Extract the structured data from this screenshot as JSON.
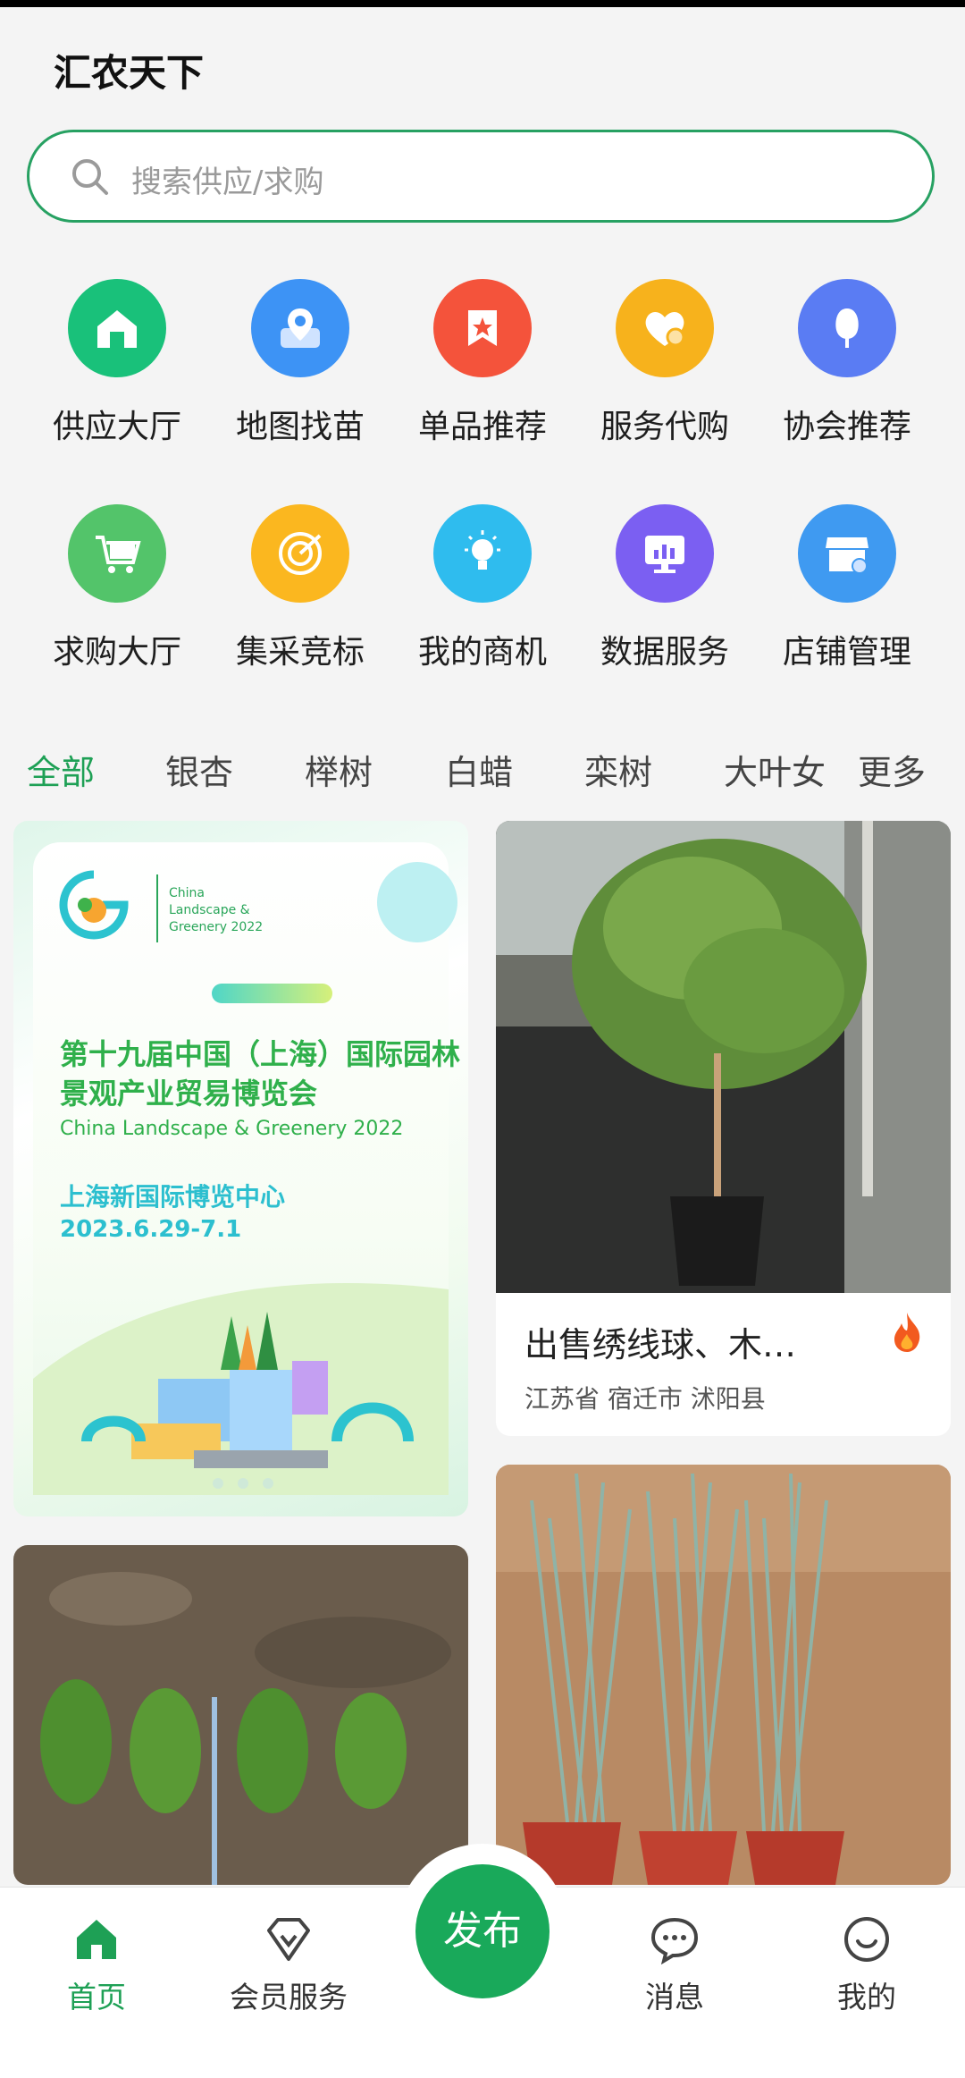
{
  "app": {
    "title": "汇农天下"
  },
  "search": {
    "placeholder": "搜索供应/求购"
  },
  "grid": [
    {
      "label": "供应大厅",
      "icon": "house-icon",
      "color": "#19c17a"
    },
    {
      "label": "地图找苗",
      "icon": "map-pin-icon",
      "color": "#3d93f5"
    },
    {
      "label": "单品推荐",
      "icon": "star-tag-icon",
      "color": "#f4533b"
    },
    {
      "label": "服务代购",
      "icon": "heart-icon",
      "color": "#f7b21c"
    },
    {
      "label": "协会推荐",
      "icon": "tree-icon",
      "color": "#5a7cf3"
    },
    {
      "label": "求购大厅",
      "icon": "cart-icon",
      "color": "#53c46a"
    },
    {
      "label": "集采竞标",
      "icon": "target-icon",
      "color": "#fbb71f"
    },
    {
      "label": "我的商机",
      "icon": "lightbulb-icon",
      "color": "#2fbcee"
    },
    {
      "label": "数据服务",
      "icon": "chart-monitor-icon",
      "color": "#7b5ff2"
    },
    {
      "label": "店铺管理",
      "icon": "shop-icon",
      "color": "#3f9af1"
    }
  ],
  "tabs": [
    "全部",
    "银杏",
    "榉树",
    "白蜡",
    "栾树",
    "大叶女",
    "更多"
  ],
  "banner": {
    "logo_text": "China Landscape & Greenery 2022",
    "title_line1": "第十九届中国（上海）国际园林",
    "title_line2": "景观产业贸易博览会",
    "subtitle": "China Landscape & Greenery 2022",
    "venue": "上海新国际博览中心",
    "dates": "2023.6.29-7.1"
  },
  "products": [
    {
      "title": "出售绣线球、木…",
      "location": "江苏省 宿迁市 沭阳县"
    }
  ],
  "nav": {
    "home": "首页",
    "vip": "会员服务",
    "publish": "发布",
    "messages": "消息",
    "mine": "我的"
  },
  "colors": {
    "accent": "#1ea055"
  }
}
